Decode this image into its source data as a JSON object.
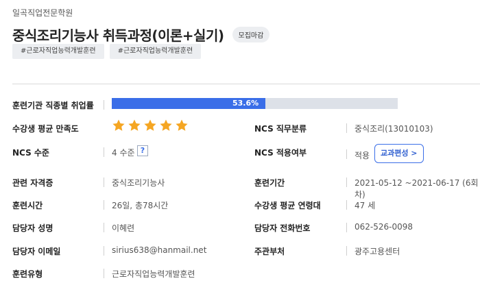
{
  "header": {
    "institute": "일곡직업전문학원",
    "course_title": "중식조리기능사 취득과정(이론+실기)",
    "status_badge": "모집마감",
    "tags": [
      "#근로자직업능력개발훈련",
      "#근로자직업능력개발훈련"
    ]
  },
  "details": {
    "employment_rate": {
      "label": "훈련기관 직종별 취업률",
      "value_text": "53.6%",
      "fraction": 0.536
    },
    "satisfaction": {
      "label": "수강생 평균 만족도",
      "stars": 5
    },
    "ncs_category": {
      "label": "NCS 직무분류",
      "value": "중식조리(13010103)"
    },
    "ncs_level": {
      "label": "NCS 수준",
      "value": "4 수준",
      "help": "?"
    },
    "ncs_applied": {
      "label": "NCS 적용여부",
      "value": "적용",
      "button": "교과편성 >"
    },
    "certificate": {
      "label": "관련 자격증",
      "value": "중식조리기능사"
    },
    "period": {
      "label": "훈련기간",
      "value": "2021-05-12 ~2021-06-17 (6회차)"
    },
    "hours": {
      "label": "훈련시간",
      "value": "26일, 총78시간"
    },
    "avg_age": {
      "label": "수강생 평균 연령대",
      "value": "47 세"
    },
    "manager_name": {
      "label": "담당자 성명",
      "value": "이혜련"
    },
    "manager_phone": {
      "label": "담당자 전화번호",
      "value": "062-526-0098"
    },
    "manager_email": {
      "label": "담당자 이메일",
      "value": "sirius638@hanmail.net"
    },
    "agency": {
      "label": "주관부처",
      "value": "광주고용센터"
    },
    "training_type": {
      "label": "훈련유형",
      "value": "근로자직업능력개발훈련"
    }
  },
  "colors": {
    "accent": "#3a6ee8",
    "star": "#f5a623",
    "bar_track": "#dde1e8"
  }
}
